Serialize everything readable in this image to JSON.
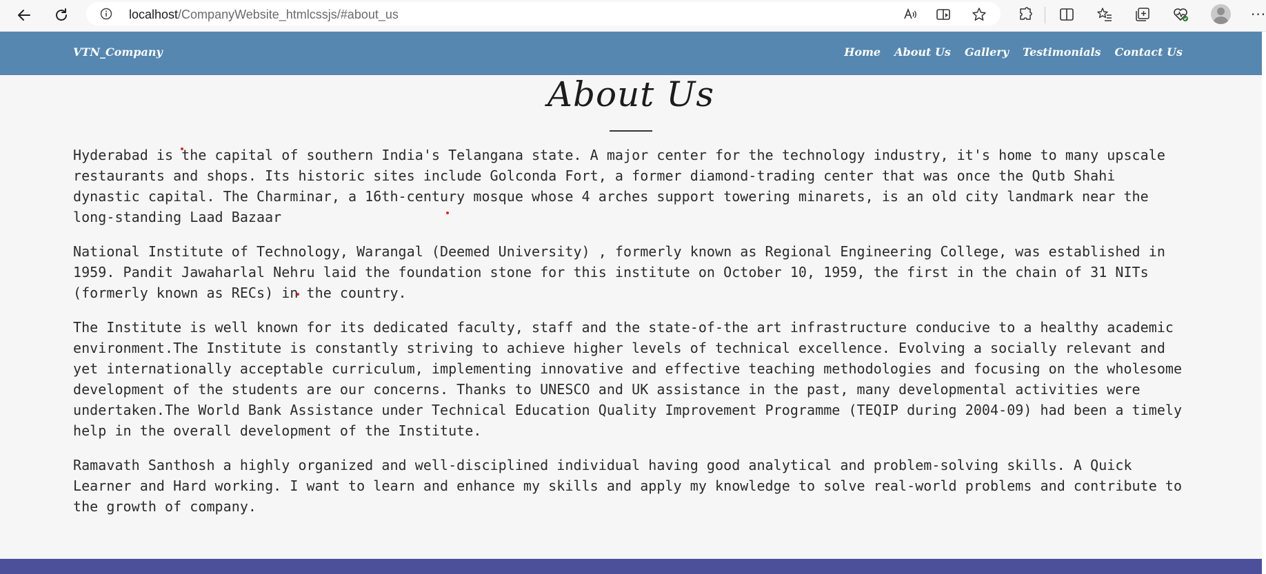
{
  "browser": {
    "url_host": "localhost",
    "url_path": "/CompanyWebsite_htmlcssjs/#about_us",
    "more_label": "···"
  },
  "site": {
    "brand": "VTN_Company",
    "nav": [
      {
        "label": "Home"
      },
      {
        "label": "About Us"
      },
      {
        "label": "Gallery"
      },
      {
        "label": "Testimonials"
      },
      {
        "label": "Contact Us"
      }
    ]
  },
  "about": {
    "title": "About Us",
    "paragraphs": [
      "Hyderabad is the capital of southern India's Telangana state. A major center for the technology industry, it's home to many upscale restaurants and shops. Its historic sites include Golconda Fort, a former diamond-trading center that was once the Qutb Shahi dynastic capital. The Charminar, a 16th-century mosque whose 4 arches support towering minarets, is an old city landmark near the long-standing Laad Bazaar",
      "National Institute of Technology, Warangal (Deemed University) , formerly known as Regional Engineering College, was established in 1959. Pandit Jawaharlal Nehru laid the foundation stone for this institute on October 10, 1959, the first in the chain of 31 NITs (formerly known as RECs) in the country.",
      "The Institute is well known for its dedicated faculty, staff and the state-of-the art infrastructure conducive to a healthy academic environment.The Institute is constantly striving to achieve higher levels of technical excellence. Evolving a socially relevant and yet internationally acceptable curriculum, implementing innovative and effective teaching methodologies and focusing on the wholesome development of the students are our concerns. Thanks to UNESCO and UK assistance in the past, many developmental activities were undertaken.The World Bank Assistance under Technical Education Quality Improvement Programme (TEQIP during 2004-09) had been a timely help in the overall development of the Institute.",
      "Ramavath Santhosh a highly organized and well-disciplined individual having good analytical and problem-solving skills. A Quick Learner and Hard working. I want to learn and enhance my skills and apply my knowledge to solve real-world problems and contribute to the growth of company."
    ]
  },
  "colors": {
    "header": "#5587b0",
    "footer": "#4c509b",
    "page_bg": "#f6f6f6",
    "marker_dot": "#e0241c"
  }
}
